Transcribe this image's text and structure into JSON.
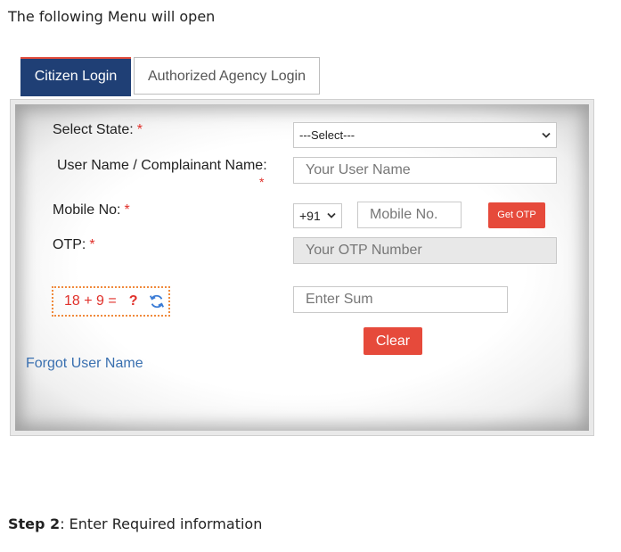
{
  "intro_text": "The following Menu will open",
  "tabs": {
    "active": "Citizen Login",
    "inactive": "Authorized Agency Login"
  },
  "form": {
    "state_label": "Select State:",
    "state_value": "---Select---",
    "username_label": "User Name / Complainant Name:",
    "username_placeholder": "Your User Name",
    "mobile_label": "Mobile No:",
    "country_code": "+91",
    "mobile_placeholder": "Mobile No.",
    "get_otp_label": "Get OTP",
    "otp_label": "OTP:",
    "otp_placeholder": "Your OTP Number",
    "captcha_expression": "18 + 9 =",
    "captcha_unknown": "?",
    "sum_placeholder": "Enter Sum",
    "clear_label": "Clear",
    "required_mark": "*"
  },
  "forgot_link": "Forgot User Name",
  "step": {
    "number": "Step 2",
    "text": ": Enter Required information"
  },
  "colors": {
    "tab_active": "#1f3f75",
    "accent_red": "#e64a3b",
    "link": "#3a70b0",
    "captcha_border": "#f08a3c"
  }
}
